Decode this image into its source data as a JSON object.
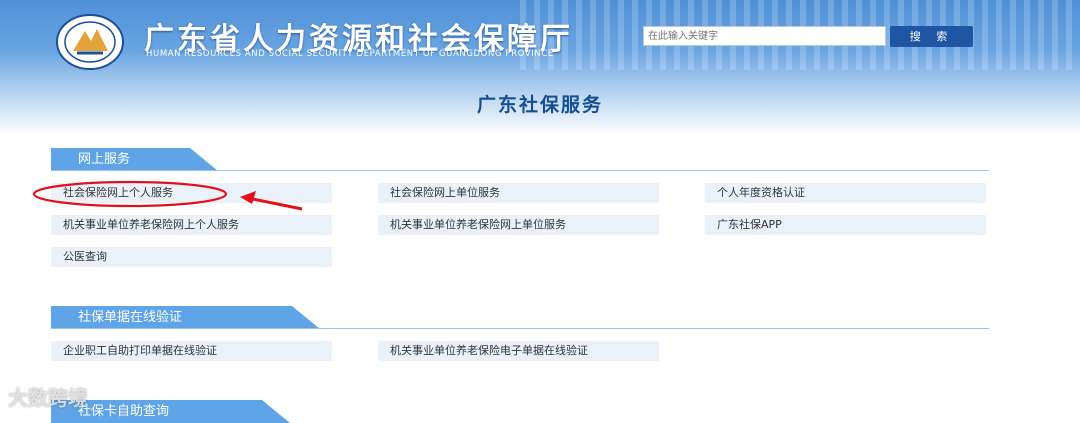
{
  "header": {
    "title": "广东省人力资源和社会保障厅",
    "subtitle": "HUMAN RESOURCES AND SOCIAL SECURITY DEPARTMENT OF GUANGDONG PROVINCE",
    "search_placeholder": "在此输入关键字",
    "search_button": "搜 索"
  },
  "page_title": "广东社保服务",
  "sections": [
    {
      "title": "网上服务",
      "items": [
        "社会保险网上个人服务",
        "社会保险网上单位服务",
        "个人年度资格认证",
        "机关事业单位养老保险网上个人服务",
        "机关事业单位养老保险网上单位服务",
        "广东社保APP",
        "公医查询"
      ]
    },
    {
      "title": "社保单据在线验证",
      "items": [
        "企业职工自助打印单据在线验证",
        "机关事业单位养老保险电子单据在线验证"
      ]
    },
    {
      "title": "社保卡自助查询"
    }
  ],
  "watermark": "大数跨境",
  "colors": {
    "accent": "#5ea4e6",
    "title": "#144f94",
    "annotation": "#e0111a"
  }
}
